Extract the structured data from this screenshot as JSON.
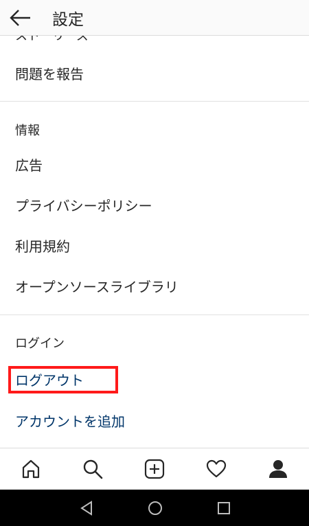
{
  "header": {
    "title": "設定",
    "back_icon": "arrow-left-icon"
  },
  "partial_row": "ストーリーズ",
  "report": {
    "label": "問題を報告"
  },
  "info": {
    "section_label": "情報",
    "items": [
      {
        "label": "広告"
      },
      {
        "label": "プライバシーポリシー"
      },
      {
        "label": "利用規約"
      },
      {
        "label": "オープンソースライブラリ"
      }
    ]
  },
  "login": {
    "section_label": "ログイン",
    "logout_label": "ログアウト",
    "add_account_label": "アカウントを追加"
  },
  "colors": {
    "link": "#003569",
    "highlight": "#ff1a1a",
    "text": "#262626"
  },
  "tabbar": {
    "icons": [
      "home-icon",
      "search-icon",
      "add-post-icon",
      "heart-icon",
      "profile-icon"
    ]
  },
  "system_nav": {
    "icons": [
      "back-triangle-icon",
      "home-circle-icon",
      "recents-square-icon"
    ]
  }
}
